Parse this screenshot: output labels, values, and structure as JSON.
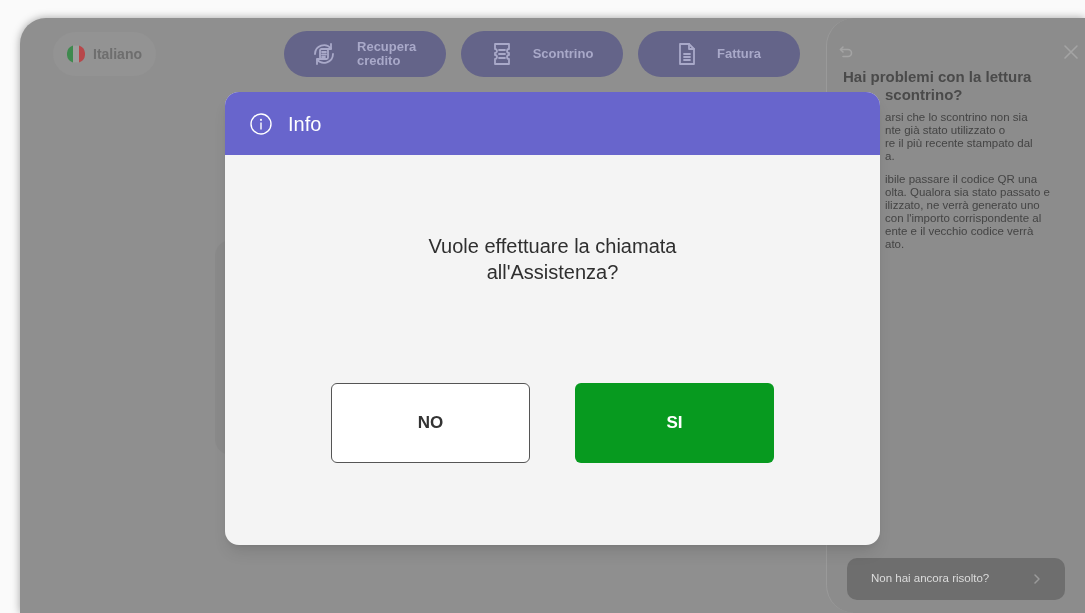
{
  "language": {
    "label": "Italiano"
  },
  "top_buttons": [
    {
      "label": "Recupera credito",
      "kind": "credit"
    },
    {
      "label": "Scontrino",
      "kind": "receipt"
    },
    {
      "label": "Fattura",
      "kind": "invoice"
    }
  ],
  "help_panel": {
    "title_lines": [
      "Hai problemi con la lettura",
      "scontrino?"
    ],
    "paragraphs": [
      [
        "arsi che lo scontrino non sia",
        "nte già stato utilizzato o",
        "re il più recente stampato dal",
        "a."
      ],
      [
        "ibile passare il codice QR una",
        "olta. Qualora sia stato passato e",
        "ilizzato, ne verrà generato uno",
        "con l'importo corrispondente al",
        "ente e il vecchio codice verrà",
        "ato."
      ]
    ],
    "footer_button": "Non hai ancora risolto?"
  },
  "dialog": {
    "title": "Info",
    "message": "Vuole effettuare la chiamata all'Assistenza?",
    "buttons": [
      {
        "label": "NO",
        "kind": "outline"
      },
      {
        "label": "SI",
        "kind": "primary"
      }
    ]
  }
}
